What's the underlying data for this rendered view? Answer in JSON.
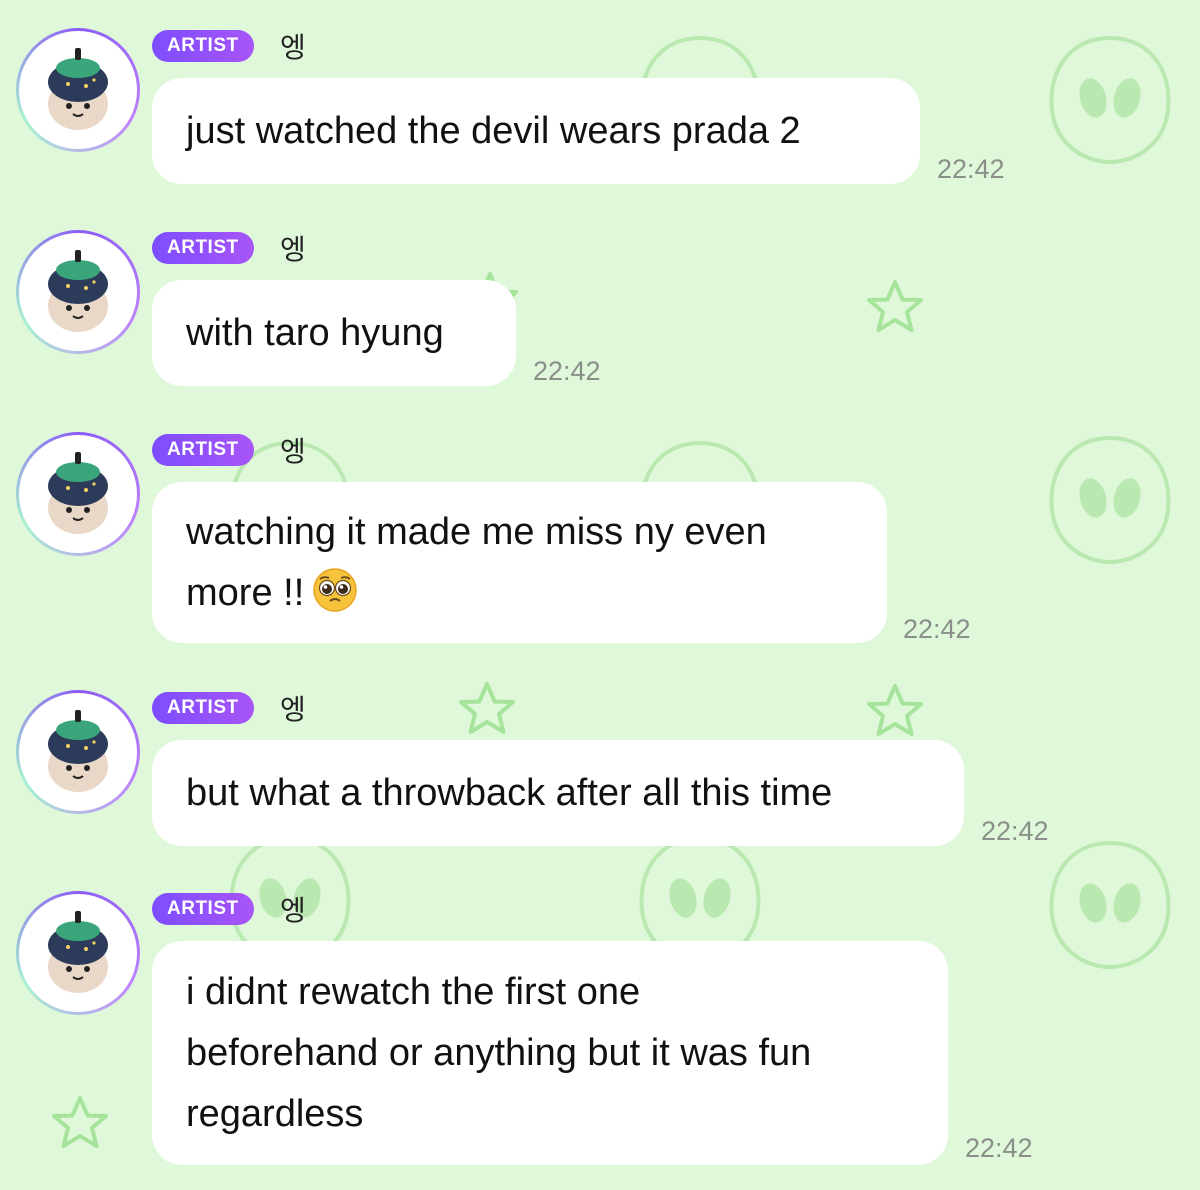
{
  "messages": [
    {
      "badge": "ARTIST",
      "sender": "엥",
      "text": "just watched the devil wears prada 2",
      "time": "22:42"
    },
    {
      "badge": "ARTIST",
      "sender": "엥",
      "text": "with taro hyung",
      "time": "22:42"
    },
    {
      "badge": "ARTIST",
      "sender": "엥",
      "text_lines": [
        "watching it made me miss ny even",
        "more !!"
      ],
      "emoji": "pleading-face-emoji",
      "time": "22:42"
    },
    {
      "badge": "ARTIST",
      "sender": "엥",
      "text": "but what a throwback after all this time",
      "time": "22:42"
    },
    {
      "badge": "ARTIST",
      "sender": "엥",
      "text_lines": [
        "i didnt rewatch the first one",
        "beforehand or anything but it was fun",
        "regardless"
      ],
      "time": "22:42"
    }
  ],
  "colors": {
    "background": "#dff8d9",
    "bubble": "#ffffff",
    "badge_gradient": [
      "#7c4dff",
      "#a855f7"
    ],
    "wallpaper_pattern": "#b9e8b0"
  },
  "icons": [
    "alien-face-pattern",
    "star-outline-pattern",
    "avatar-plush-icon"
  ]
}
